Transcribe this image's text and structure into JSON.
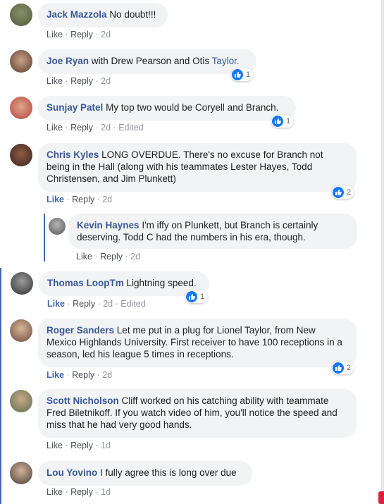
{
  "comments": [
    {
      "name": "Jack Mazzola",
      "text": "No doubt!!!",
      "like": "Like",
      "reply": "Reply",
      "time": "2d",
      "edited": "",
      "reactions": ""
    },
    {
      "name": "Joe Ryan",
      "text": "with Drew Pearson and Otis ",
      "link": "Taylor.",
      "like": "Like",
      "reply": "Reply",
      "time": "2d",
      "edited": "",
      "reactions": "1"
    },
    {
      "name": "Sunjay Patel",
      "text": "My top two would be Coryell and Branch.",
      "like": "Like",
      "reply": "Reply",
      "time": "2d",
      "edited": "Edited",
      "reactions": "1"
    },
    {
      "name": "Chris Kyles",
      "text": "LONG OVERDUE. There's no excuse for Branch not being in the Hall (along with his teammates Lester Hayes, Todd Christensen, and Jim Plunkett)",
      "like": "Like",
      "reply": "Reply",
      "time": "2d",
      "edited": "",
      "reactions": "2"
    },
    {
      "name": "Kevin Haynes",
      "text": "I'm iffy on Plunkett, but Branch is certainly deserving. Todd C had the numbers in his era, though.",
      "like": "Like",
      "reply": "Reply",
      "time": "2d",
      "edited": "",
      "reactions": ""
    },
    {
      "name": "Thomas LoopTm",
      "text": "Lightning speed.",
      "like": "Like",
      "reply": "Reply",
      "time": "2d",
      "edited": "Edited",
      "reactions": "1"
    },
    {
      "name": "Roger Sanders",
      "text": "Let me put in a plug for Lionel Taylor, from New Mexico Highlands University. First receiver to have 100 receptions in a season, led his league 5 times in receptions.",
      "like": "Like",
      "reply": "Reply",
      "time": "2d",
      "edited": "",
      "reactions": "2"
    },
    {
      "name": "Scott Nicholson",
      "text": "Cliff worked on his catching ability with teammate Fred Biletnikoff. If you watch video of him, you'll notice the speed and miss that he had very good hands.",
      "like": "Like",
      "reply": "Reply",
      "time": "1d",
      "edited": "",
      "reactions": ""
    },
    {
      "name": "Lou Yovino",
      "text": "I fully agree this is long over due",
      "like": "Like",
      "reply": "Reply",
      "time": "1d",
      "edited": "",
      "reactions": ""
    }
  ],
  "colors": {
    "name": "#385898",
    "bubble": "#f2f3f5",
    "like_active": "#4267b2",
    "reaction": "#1877f2"
  },
  "icons": {
    "reaction": "thumbs-up-icon"
  }
}
